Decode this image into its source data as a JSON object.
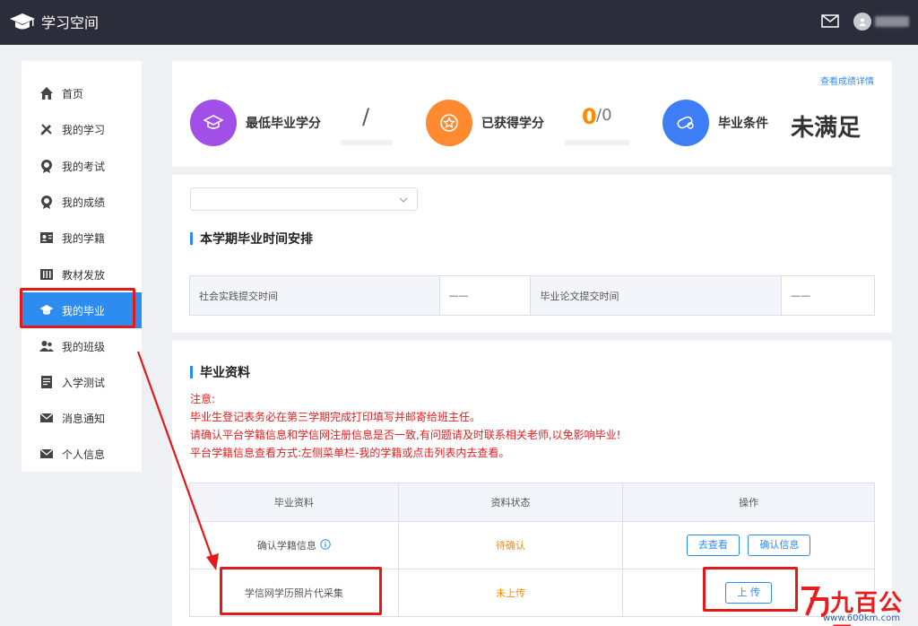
{
  "app": {
    "title": "学习空间"
  },
  "sidebar": {
    "items": [
      {
        "label": "首页",
        "icon": "home-icon"
      },
      {
        "label": "我的学习",
        "icon": "pencil-ruler-icon"
      },
      {
        "label": "我的考试",
        "icon": "medal-icon"
      },
      {
        "label": "我的成绩",
        "icon": "medal-icon"
      },
      {
        "label": "我的学籍",
        "icon": "id-card-icon"
      },
      {
        "label": "教材发放",
        "icon": "books-icon"
      },
      {
        "label": "我的毕业",
        "icon": "graduation-cap-icon",
        "active": true
      },
      {
        "label": "我的班级",
        "icon": "users-icon"
      },
      {
        "label": "入学测试",
        "icon": "document-icon"
      },
      {
        "label": "消息通知",
        "icon": "mail-icon"
      },
      {
        "label": "个人信息",
        "icon": "mail-icon"
      }
    ]
  },
  "summary": {
    "detail_link": "查看成绩详情",
    "min_credits_label": "最低毕业学分",
    "min_credits_value": "/",
    "earned_label": "已获得学分",
    "earned_value": "0",
    "earned_total": "/0",
    "condition_label": "毕业条件",
    "condition_value": "未满足"
  },
  "schedule": {
    "title": "本学期毕业时间安排",
    "social_practice_label": "社会实践提交时间",
    "social_practice_value": "——",
    "thesis_label": "毕业论文提交时间",
    "thesis_value": "——"
  },
  "materials": {
    "title": "毕业资料",
    "notes": [
      "注意:",
      "毕业生登记表务必在第三学期完成打印填写并邮寄给班主任。",
      "请确认平台学籍信息和学信网注册信息是否一致,有问题请及时联系相关老师,以免影响毕业!",
      "平台学籍信息查看方式:左侧菜单栏-我的学籍或点击列表内去查看。"
    ],
    "headers": [
      "毕业资料",
      "资料状态",
      "操作"
    ],
    "rows": [
      {
        "name": "确认学籍信息",
        "status": "待确认",
        "actions": [
          "去查看",
          "确认信息"
        ]
      },
      {
        "name": "学信网学历照片代采集",
        "status": "未上传",
        "actions": [
          "上 传"
        ]
      }
    ]
  },
  "watermark": {
    "text": "九百公里",
    "url": "www.600km.com"
  },
  "colors": {
    "accent": "#2d8cf0",
    "topbar": "#2b2d3a",
    "warning": "#e02020",
    "pending": "#ff8a00",
    "purple": "#a24fe8",
    "orange": "#ff8a30",
    "blue": "#3d7df5"
  }
}
